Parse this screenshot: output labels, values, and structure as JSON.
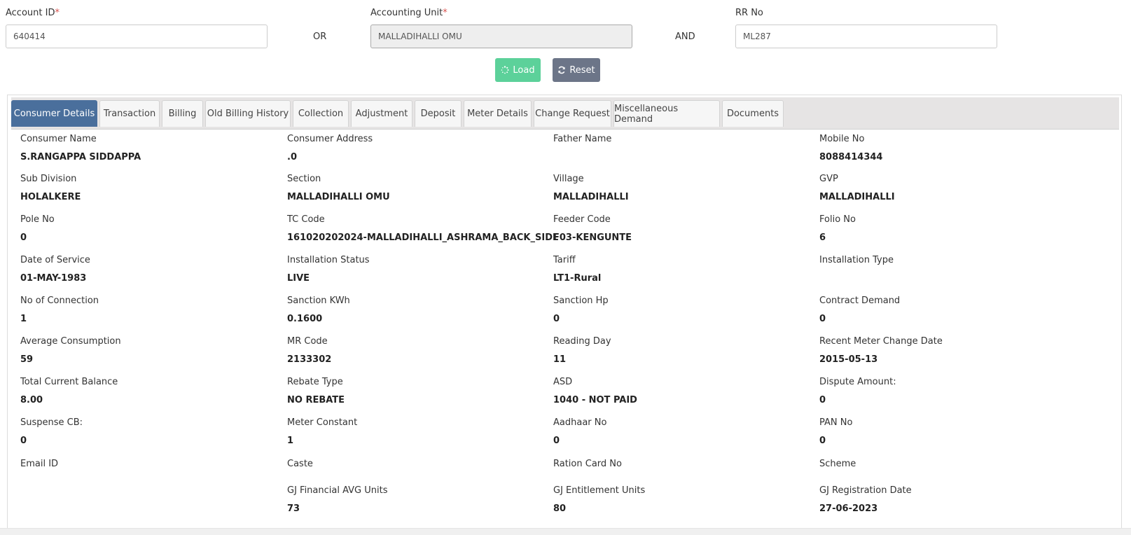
{
  "form": {
    "account_id_label": "Account ID",
    "account_id_value": "640414",
    "or_text": "OR",
    "accounting_unit_label": "Accounting Unit",
    "accounting_unit_value": "MALLADIHALLI OMU",
    "and_text": "AND",
    "rr_no_label": "RR No",
    "rr_no_value": "ML287",
    "required_mark": "*",
    "load_label": "Load",
    "reset_label": "Reset"
  },
  "tabs": [
    {
      "label": "Consumer Details",
      "active": true
    },
    {
      "label": "Transaction"
    },
    {
      "label": "Billing"
    },
    {
      "label": "Old Billing History"
    },
    {
      "label": "Collection"
    },
    {
      "label": "Adjustment"
    },
    {
      "label": "Deposit"
    },
    {
      "label": "Meter Details"
    },
    {
      "label": "Change Request"
    },
    {
      "label": "Miscellaneous Demand"
    },
    {
      "label": "Documents"
    }
  ],
  "fields": [
    {
      "label": "Consumer Name",
      "value": "S.RANGAPPA SIDDAPPA"
    },
    {
      "label": "Consumer Address",
      "value": ".0"
    },
    {
      "label": "Father Name",
      "value": ""
    },
    {
      "label": "Mobile No",
      "value": "8088414344"
    },
    {
      "label": "Sub Division",
      "value": "HOLALKERE"
    },
    {
      "label": "Section",
      "value": "MALLADIHALLI OMU"
    },
    {
      "label": "Village",
      "value": "MALLADIHALLI"
    },
    {
      "label": "GVP",
      "value": "MALLADIHALLI"
    },
    {
      "label": "Pole No",
      "value": "0"
    },
    {
      "label": "TC Code",
      "value": "161020202024-MALLADIHALLI_ASHRAMA_BACK_SIDE"
    },
    {
      "label": "Feeder Code",
      "value": "F03-KENGUNTE"
    },
    {
      "label": "Folio No",
      "value": "6"
    },
    {
      "label": "Date of Service",
      "value": "01-MAY-1983"
    },
    {
      "label": "Installation Status",
      "value": "LIVE"
    },
    {
      "label": "Tariff",
      "value": "LT1-Rural"
    },
    {
      "label": "Installation Type",
      "value": ""
    },
    {
      "label": "No of Connection",
      "value": "1"
    },
    {
      "label": "Sanction KWh",
      "value": "0.1600"
    },
    {
      "label": "Sanction Hp",
      "value": "0"
    },
    {
      "label": "Contract Demand",
      "value": "0"
    },
    {
      "label": "Average Consumption",
      "value": "59"
    },
    {
      "label": "MR Code",
      "value": "2133302"
    },
    {
      "label": "Reading Day",
      "value": "11"
    },
    {
      "label": "Recent Meter Change Date",
      "value": "2015-05-13"
    },
    {
      "label": "Total Current Balance",
      "value": "8.00"
    },
    {
      "label": "Rebate Type",
      "value": "NO REBATE"
    },
    {
      "label": "ASD",
      "value": "1040 - NOT PAID"
    },
    {
      "label": "Dispute Amount:",
      "value": "0"
    },
    {
      "label": "Suspense CB:",
      "value": "0"
    },
    {
      "label": "Meter Constant",
      "value": "1"
    },
    {
      "label": "Aadhaar No",
      "value": "0"
    },
    {
      "label": "PAN No",
      "value": "0"
    },
    {
      "label": "Email ID",
      "value": ""
    },
    {
      "label": "Caste",
      "value": ""
    },
    {
      "label": "Ration Card No",
      "value": ""
    },
    {
      "label": "Scheme",
      "value": ""
    },
    {
      "label": "",
      "value": ""
    },
    {
      "label": "GJ Financial AVG Units",
      "value": "73"
    },
    {
      "label": "GJ Entitlement Units",
      "value": "80"
    },
    {
      "label": "GJ Registration Date",
      "value": "27-06-2023"
    }
  ]
}
